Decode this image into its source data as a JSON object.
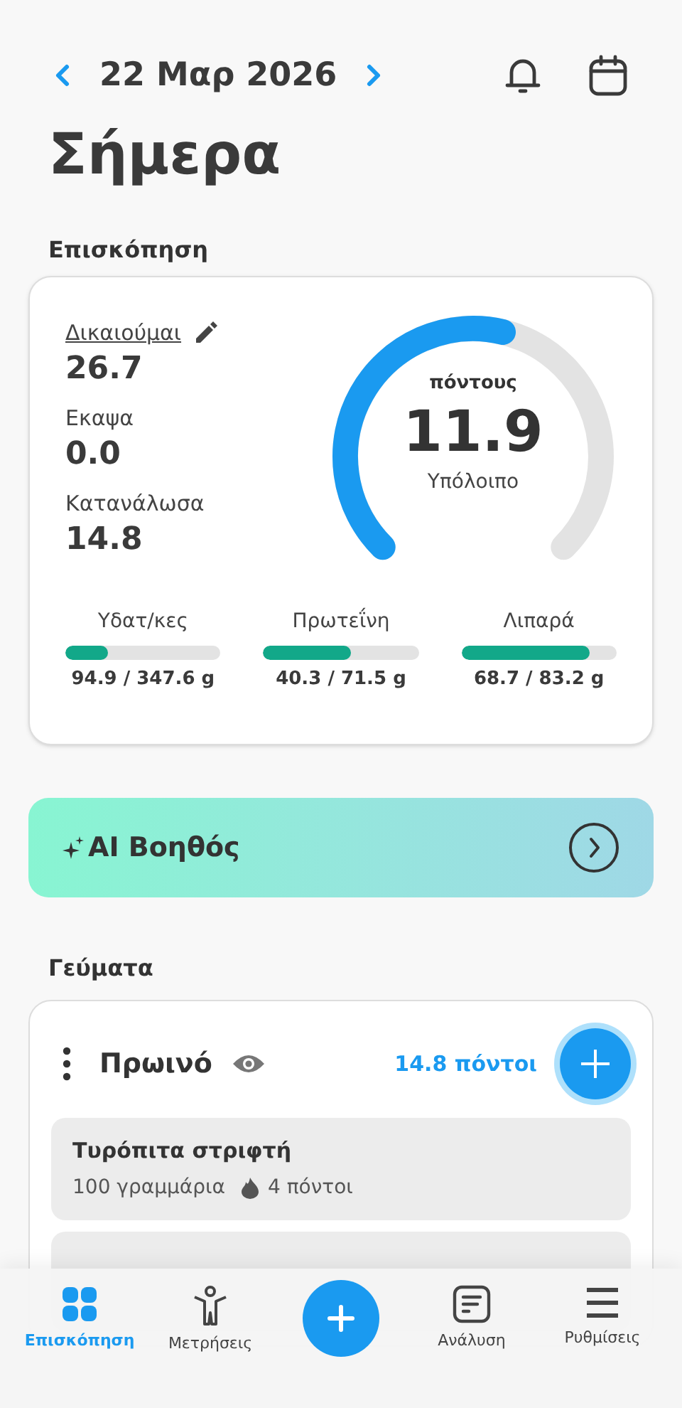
{
  "header": {
    "date": "22 Μαρ 2026",
    "title": "Σήμερα"
  },
  "overview": {
    "heading": "Επισκόπηση",
    "stats": [
      {
        "label": "Δικαιούμαι",
        "value": "26.7",
        "editable": true
      },
      {
        "label": "Εκαψα",
        "value": "0.0",
        "editable": false
      },
      {
        "label": "Κατανάλωσα",
        "value": "14.8",
        "editable": false
      }
    ],
    "gauge": {
      "unit": "πόντους",
      "value": "11.9",
      "caption": "Υπόλοιπο"
    },
    "macros": [
      {
        "name": "Υδατ/κες",
        "level": 0.27,
        "reading": "94.9 / 347.6 g"
      },
      {
        "name": "Πρωτεΐνη",
        "level": 0.56,
        "reading": "40.3 / 71.5 g"
      },
      {
        "name": "Λιπαρά",
        "level": 0.83,
        "reading": "68.7 / 83.2 g"
      }
    ]
  },
  "assistant": {
    "label": "AI Βοηθός"
  },
  "meals": {
    "heading": "Γεύματα",
    "items": [
      {
        "name": "Πρωινό",
        "points": "14.8 πόντοι",
        "foods": [
          {
            "name": "Τυρόπιτα στριφτή",
            "amount": "100 γραμμάρια",
            "points": "4 πόντοι"
          }
        ]
      }
    ]
  },
  "nav": [
    {
      "kind": "tab",
      "label": "Επισκόπηση",
      "selected": true
    },
    {
      "kind": "tab",
      "label": "Μετρήσεις",
      "selected": false
    },
    {
      "kind": "fab"
    },
    {
      "kind": "tab",
      "label": "Ανάλυση",
      "selected": false
    },
    {
      "kind": "tab",
      "label": "Ρυθμίσεις",
      "selected": false
    }
  ]
}
